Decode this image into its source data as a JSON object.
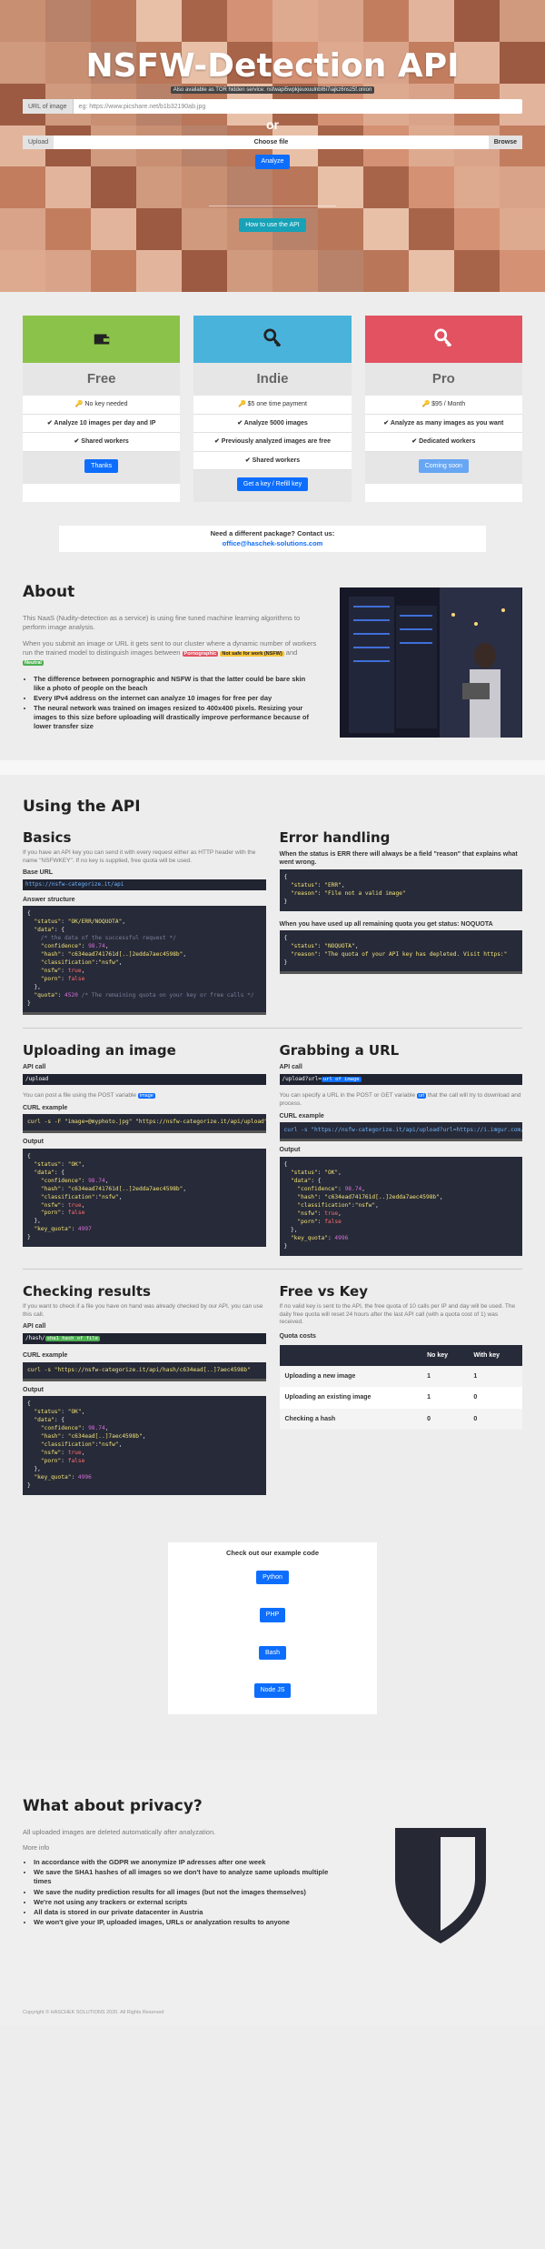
{
  "hero": {
    "title": "NSFW-Detection API",
    "tor": "Also available as TOR hidden service: nsfwapi5wpkjeuxuulnbt6i7iajkz6nsz5f.onion",
    "url_label": "URL of image",
    "url_placeholder": "eg: https://www.picshare.net/b1b32190ab.jpg",
    "or": "or",
    "upload_label": "Upload",
    "choose_file": "Choose file",
    "browse": "Browse",
    "analyze": "Analyze",
    "how_to": "How to use the API"
  },
  "plans": [
    {
      "name": "Free",
      "color": "#8bc34a",
      "f1": "🔑 No key needed",
      "f2": "✔ Analyze 10 images per day and IP",
      "f3": "✔ Shared workers",
      "f4": "",
      "action": "Thanks",
      "btn_color": "#0d6efd"
    },
    {
      "name": "Indie",
      "color": "#4ab3dc",
      "f1": "🔑 $5 one time payment",
      "f2": "✔ Analyze 5000 images",
      "f3": "✔ Previously analyzed images are free",
      "f4": "✔ Shared workers",
      "action": "Get a key / Refill key",
      "btn_color": "#0d6efd"
    },
    {
      "name": "Pro",
      "color": "#e25261",
      "f1": "🔑 $95 / Month",
      "f2": "✔ Analyze as many images as you want",
      "f3": "✔ Dedicated workers",
      "f4": "",
      "action": "Coming soon",
      "btn_color": "#67a6f3"
    }
  ],
  "contact": {
    "text": "Need a different package? Contact us:",
    "email": "office@haschek-solutions.com"
  },
  "about": {
    "title": "About",
    "p1": "This NaaS (Nudity-detection as a service) is using fine tuned machine learning algorithms to perform image analysis.",
    "p2a": "When you submit an image or URL it gets sent to our cluster where a dynamic number of workers run the trained model to distinguish images between",
    "tag1": "Pornographic",
    "tag2": "Not safe for work (NSFW)",
    "and": "and",
    "tag3": "Neutral",
    "bullets": [
      "The difference between pornographic and NSFW is that the latter could be bare skin like a photo of people on the beach",
      "Every IPv4 address on the internet can analyze 10 images for free per day",
      "The neural network was trained on images resized to 400x400 pixels. Resizing your images to this size before uploading will drastically improve performance because of lower transfer size"
    ]
  },
  "api": {
    "title": "Using the API",
    "basics": {
      "title": "Basics",
      "p": "If you have an API key you can send it with every request either as HTTP header with the name \"NSFWKEY\". If no key is supplied, free quota will be used.",
      "base_url_label": "Base URL",
      "base_url": "https://nsfw-categorize.it/api",
      "answer_label": "Answer structure"
    },
    "errors": {
      "title": "Error handling",
      "p1": "When the status is ERR there will always be a field \"reason\" that explains what went wrong.",
      "p2": "When you have used up all remaining quota you get status: NOQUOTA"
    },
    "upload": {
      "title": "Uploading an image",
      "call_label": "API call",
      "call": "/upload",
      "p": "You can post a file using the POST variable",
      "var": "image",
      "curl_label": "CURL example",
      "curl": "curl -s -F \"image=@myphoto.jpg\" \"https://nsfw-categorize.it/api/upload\"",
      "out_label": "Output"
    },
    "grab": {
      "title": "Grabbing a URL",
      "call_label": "API call",
      "call": "/upload?url=",
      "call_var": "url of image",
      "p1": "You can specify a URL in the POST or GET variable",
      "var": "url",
      "p2": "that the call will try to download and process.",
      "curl_label": "CURL example",
      "curl": "curl -s \"https://nsfw-categorize.it/api/upload?url=https://i.imgur.com/abc.jpg\"",
      "out_label": "Output"
    },
    "check": {
      "title": "Checking results",
      "p": "If you want to check if a file you have on hand was already checked by our API, you can use this call.",
      "call_label": "API call",
      "call": "/hash/",
      "call_var": "sha1 hash of file",
      "curl_label": "CURL example",
      "curl": "curl -s \"https://nsfw-categorize.it/api/hash/c634ead[..]7aec4598b\"",
      "out_label": "Output"
    },
    "freekey": {
      "title": "Free vs Key",
      "p": "If no valid key is sent to the API, the free quota of 10 calls per IP and day will be used. The daily free quota will reset 24 hours after the last API call (with a quota cost of 1) was received.",
      "quota_label": "Quota costs",
      "headers": [
        "",
        "No key",
        "With key"
      ],
      "rows": [
        [
          "Uploading a new image",
          "1",
          "1"
        ],
        [
          "Uploading an existing image",
          "1",
          "0"
        ],
        [
          "Checking a hash",
          "0",
          "0"
        ]
      ]
    }
  },
  "examples": {
    "title": "Check out our example code",
    "buttons": [
      "Python",
      "PHP",
      "Bash",
      "Node JS"
    ]
  },
  "privacy": {
    "title": "What about privacy?",
    "p": "All uploaded images are deleted automatically after analyzation.",
    "more": "More info",
    "bullets": [
      "In accordance with the GDPR we anonymize IP adresses after one week",
      "We save the SHA1 hashes of all images so we don't have to analyze same uploads multiple times",
      "We save the nudity prediction results for all images (but not the images themselves)",
      "We're not using any trackers or external scripts",
      "All data is stored in our private datacenter in Austria",
      "We won't give your IP, uploaded images, URLs or analyzation results to anyone"
    ]
  },
  "footer": {
    "text": "Copyright © HASCHEK SOLUTIONS 2020. All Rights Reserved"
  }
}
